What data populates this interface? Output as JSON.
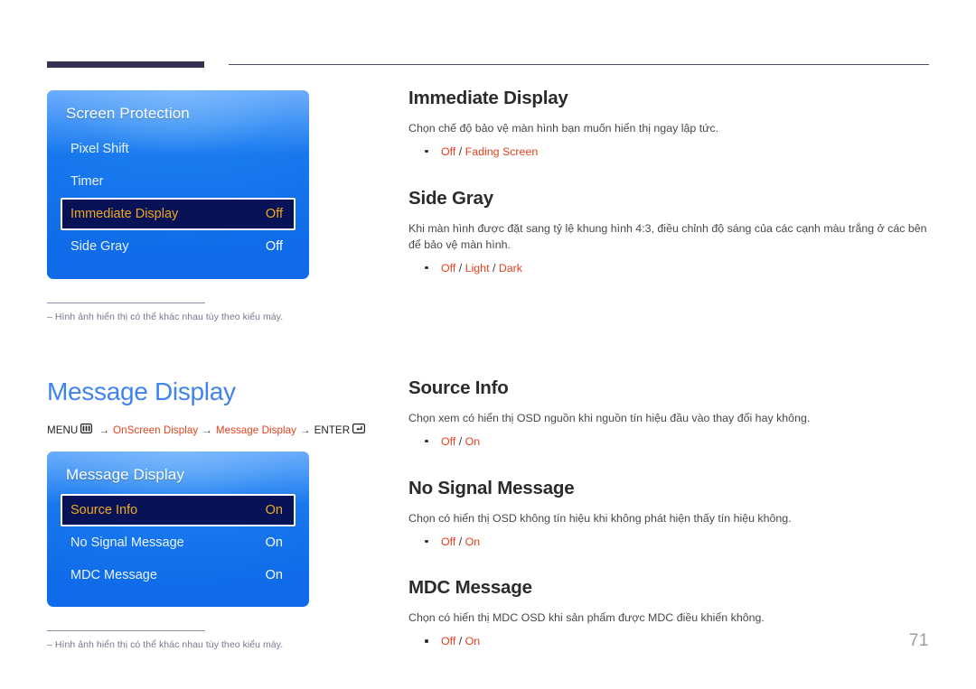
{
  "page": {
    "number": "71"
  },
  "top_section": {
    "osd": {
      "title": "Screen Protection",
      "rows": [
        {
          "label": "Pixel Shift",
          "value": "",
          "selected": false
        },
        {
          "label": "Timer",
          "value": "",
          "selected": false
        },
        {
          "label": "Immediate Display",
          "value": "Off",
          "selected": true
        },
        {
          "label": "Side Gray",
          "value": "Off",
          "selected": false
        }
      ]
    },
    "footnote": {
      "dash": "‒",
      "text": "Hình ảnh hiển thị có thể khác nhau tùy theo kiểu máy."
    },
    "articles": [
      {
        "title": "Immediate Display",
        "body": "Chọn chế độ bảo vệ màn hình bạn muốn hiển thị ngay lập tức.",
        "options": [
          "Off",
          "Fading Screen"
        ]
      },
      {
        "title": "Side Gray",
        "body": "Khi màn hình được đặt sang tỷ lệ khung hình 4:3, điều chỉnh độ sáng của các cạnh màu trắng ở các bên để bảo vệ màn hình.",
        "options": [
          "Off",
          "Light",
          "Dark"
        ]
      }
    ]
  },
  "bottom_section": {
    "heading": "Message Display",
    "menu_path": {
      "menu_label": "MENU",
      "menu_icon": "menu-icon",
      "arrow": "→",
      "step1": "OnScreen Display",
      "step2": "Message Display",
      "enter_label": "ENTER",
      "enter_icon": "enter-icon"
    },
    "osd": {
      "title": "Message Display",
      "rows": [
        {
          "label": "Source Info",
          "value": "On",
          "selected": true
        },
        {
          "label": "No Signal Message",
          "value": "On",
          "selected": false
        },
        {
          "label": "MDC Message",
          "value": "On",
          "selected": false
        }
      ]
    },
    "footnote": {
      "dash": "‒",
      "text": "Hình ảnh hiển thị có thể khác nhau tùy theo kiểu máy."
    },
    "articles": [
      {
        "title": "Source Info",
        "body": "Chọn xem có hiển thị OSD nguồn khi nguồn tín hiệu đầu vào thay đổi hay không.",
        "options": [
          "Off",
          "On"
        ]
      },
      {
        "title": "No Signal Message",
        "body": "Chọn có hiển thị OSD không tín hiệu khi không phát hiện thấy tín hiệu không.",
        "options": [
          "Off",
          "On"
        ]
      },
      {
        "title": "MDC Message",
        "body": "Chọn có hiển thị MDC OSD khi sản phẩm được MDC điều khiển không.",
        "options": [
          "Off",
          "On"
        ]
      }
    ]
  },
  "colors": {
    "accent_orange": "#e2411f",
    "heading_blue": "#3e84f0",
    "osd_blue": "#1a7cf0",
    "osd_selected_bg": "#071257",
    "osd_selected_text": "#f0a81e",
    "rule_navy": "#333351",
    "footnote_gray": "#77778f",
    "page_number_gray": "#9b9b9b"
  }
}
